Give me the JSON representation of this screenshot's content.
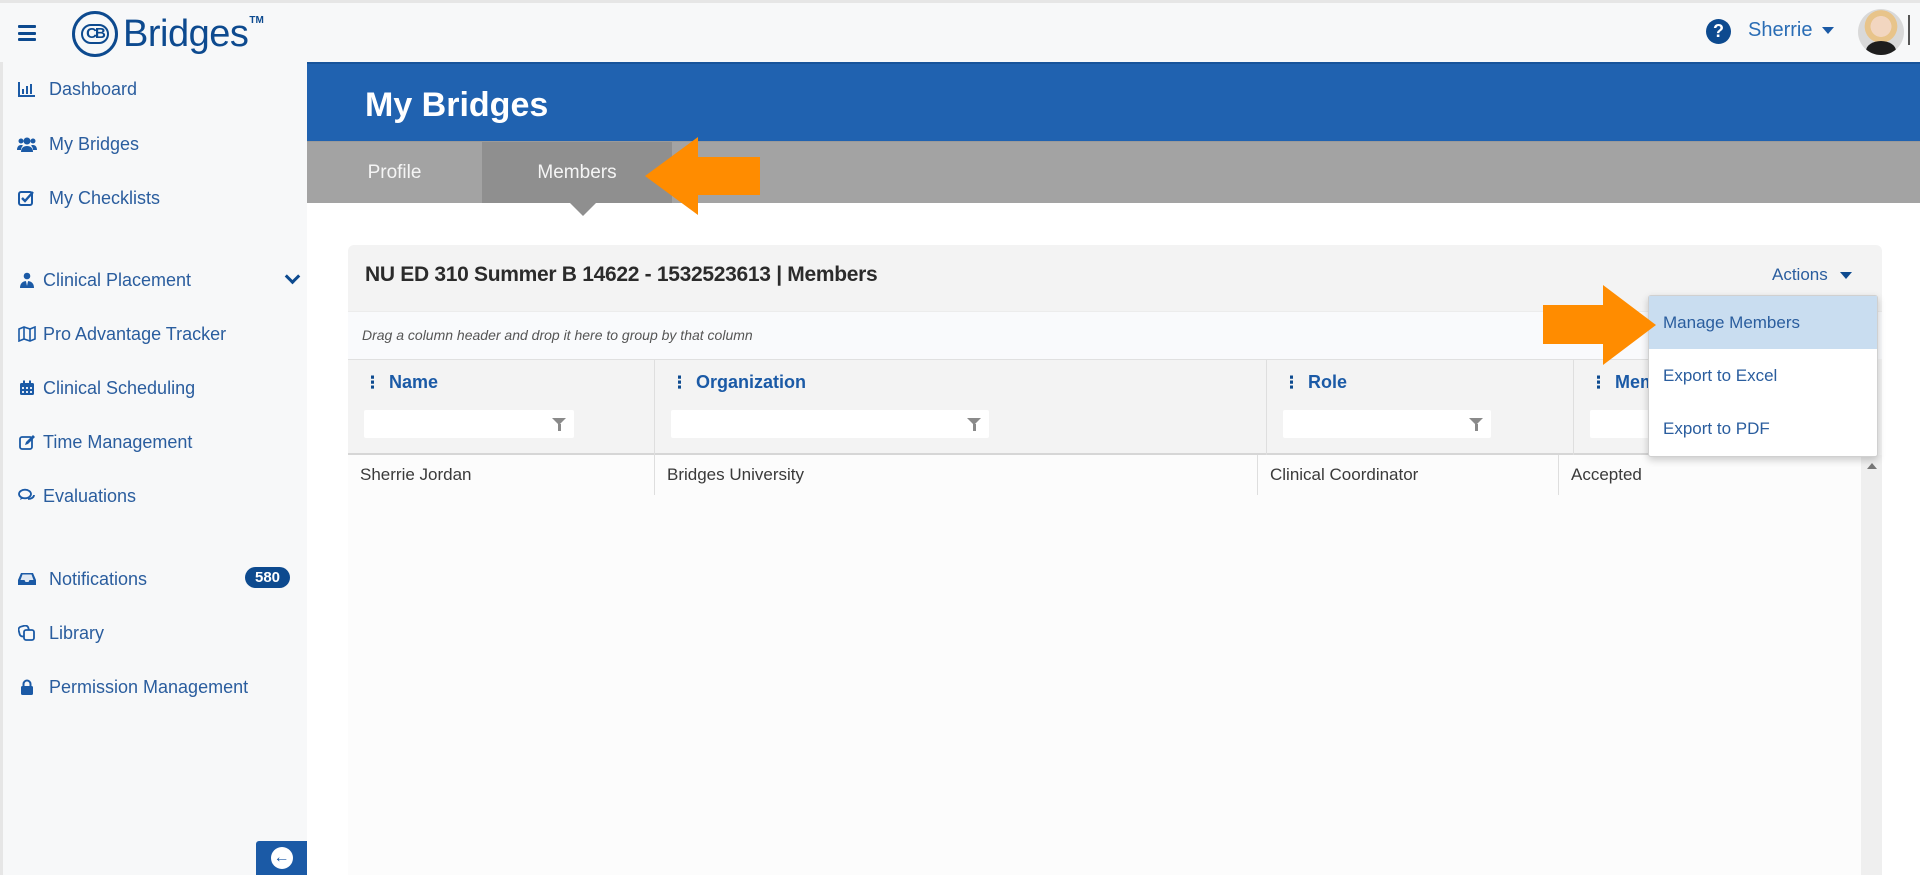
{
  "topbar": {
    "brand": "Bridges",
    "brand_mark": "CB",
    "trademark": "TM",
    "help_icon": "?",
    "user_name": "Sherrie"
  },
  "sidebar": {
    "items": [
      {
        "label": "Dashboard",
        "icon": "bar-chart-icon",
        "glyph": "▥"
      },
      {
        "label": "My Bridges",
        "icon": "users-icon",
        "glyph": "👥"
      },
      {
        "label": "My Checklists",
        "icon": "checkbox-icon",
        "glyph": "☑"
      },
      {
        "label": "Clinical Placement",
        "icon": "user-tie-icon",
        "glyph": "♣"
      },
      {
        "label": "Pro Advantage Tracker",
        "icon": "map-icon",
        "glyph": "🕮"
      },
      {
        "label": "Clinical Scheduling",
        "icon": "calendar-icon",
        "glyph": "▦"
      },
      {
        "label": "Time Management",
        "icon": "edit-icon",
        "glyph": "✎"
      },
      {
        "label": "Evaluations",
        "icon": "comments-icon",
        "glyph": "💬"
      },
      {
        "label": "Notifications",
        "icon": "inbox-icon",
        "glyph": "▬",
        "badge": "580"
      },
      {
        "label": "Library",
        "icon": "clone-icon",
        "glyph": "❐"
      },
      {
        "label": "Permission Management",
        "icon": "lock-icon",
        "glyph": "🔒"
      }
    ],
    "collapse_glyph": "←"
  },
  "page": {
    "title": "My Bridges",
    "tabs": [
      {
        "label": "Profile",
        "active": false
      },
      {
        "label": "Members",
        "active": true
      }
    ]
  },
  "card": {
    "title": "NU ED 310 Summer B 14622 - 1532523613 | Members",
    "actions_label": "Actions",
    "group_hint": "Drag a column header and drop it here to group by that column",
    "columns": [
      {
        "label": "Name",
        "filter_value": ""
      },
      {
        "label": "Organization",
        "filter_value": ""
      },
      {
        "label": "Role",
        "filter_value": ""
      },
      {
        "label": "Mem",
        "filter_value": ""
      }
    ],
    "kebab_glyph": "⋮",
    "rows": [
      {
        "name": "Sherrie Jordan",
        "organization": "Bridges University",
        "role": "Clinical Coordinator",
        "membership": "Accepted"
      }
    ]
  },
  "actions_menu": {
    "items": [
      {
        "label": "Manage Members",
        "highlighted": true
      },
      {
        "label": "Export to Excel",
        "highlighted": false
      },
      {
        "label": "Export to PDF",
        "highlighted": false
      }
    ]
  },
  "colors": {
    "brand_blue": "#0d4a8f",
    "header_blue": "#2062b0",
    "tab_gray": "#a3a3a3",
    "tab_active_gray": "#8f8f8f",
    "annotation_orange": "#ff8c00",
    "menu_highlight": "#c9ddf0"
  }
}
